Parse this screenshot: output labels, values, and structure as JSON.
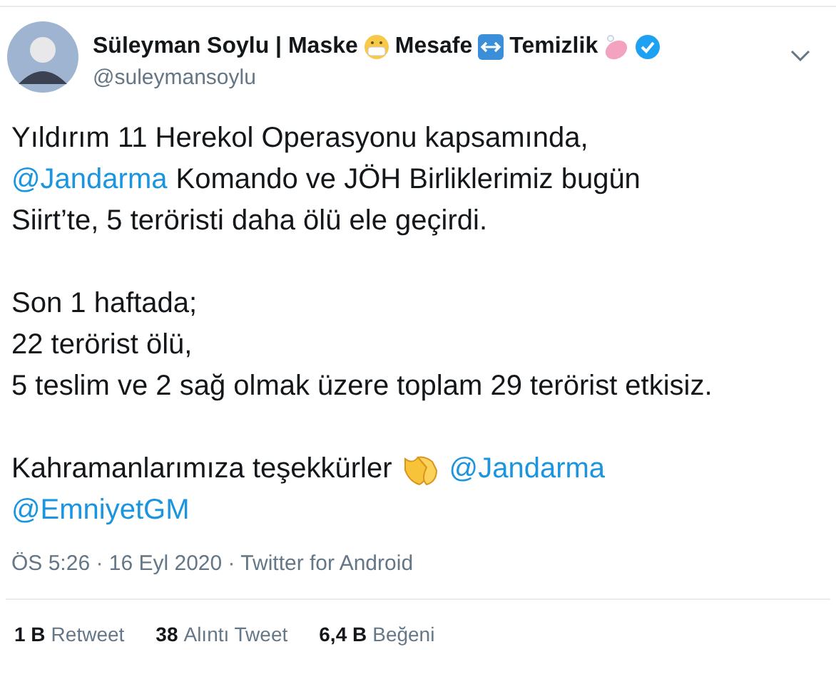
{
  "author": {
    "name_parts": [
      {
        "text": "Süleyman Soylu | Maske",
        "kind": "mask"
      },
      {
        "text": "Mesafe",
        "kind": "arrows"
      },
      {
        "text": "Temizlik",
        "kind": "soap"
      }
    ],
    "verified": true,
    "handle": "@suleymansoylu"
  },
  "paragraphs": [
    [
      [
        {
          "kind": "text",
          "text": "Yıldırım 11 Herekol Operasyonu kapsamında,"
        }
      ],
      [
        {
          "kind": "mention",
          "text": "@Jandarma"
        },
        {
          "kind": "text",
          "text": "Komando ve JÖH Birliklerimiz bugün"
        }
      ],
      [
        {
          "kind": "text",
          "text": "Siirt’te, 5 teröristi daha ölü ele geçirdi."
        }
      ]
    ],
    [
      [
        {
          "kind": "text",
          "text": "Son 1 haftada;"
        }
      ],
      [
        {
          "kind": "text",
          "text": "22 terörist ölü,"
        }
      ],
      [
        {
          "kind": "text",
          "text": "5 teslim ve 2 sağ olmak üzere toplam 29 terörist etkisiz."
        }
      ]
    ],
    [
      [
        {
          "kind": "text",
          "text": "Kahramanlarımıza teşekkürler"
        },
        {
          "kind": "clap"
        },
        {
          "kind": "mention",
          "text": "@Jandarma"
        }
      ],
      [
        {
          "kind": "mention",
          "text": "@EmniyetGM"
        }
      ]
    ]
  ],
  "meta": "ÖS 5:26 · 16 Eyl 2020 · Twitter for Android",
  "stats": [
    {
      "count": "1 B",
      "label": "Retweet"
    },
    {
      "count": "38",
      "label": "Alıntı Tweet"
    },
    {
      "count": "6,4 B",
      "label": "Beğeni"
    }
  ]
}
